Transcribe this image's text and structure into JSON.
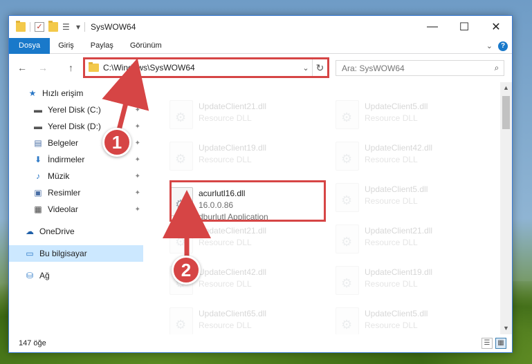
{
  "window": {
    "title": "SysWOW64",
    "controls": {
      "minimize": "—",
      "maximize": "☐",
      "close": "✕"
    }
  },
  "quick_access_toolbar": {
    "dropdown": "▾"
  },
  "ribbon": {
    "tabs": [
      "Dosya",
      "Giriş",
      "Paylaş",
      "Görünüm"
    ],
    "expand": "⌄",
    "help": "?"
  },
  "navigation": {
    "back": "←",
    "forward": "→",
    "up": "↑"
  },
  "address_bar": {
    "path": "C:\\Windows\\SysWOW64",
    "dropdown": "⌄",
    "refresh": "↻"
  },
  "search": {
    "placeholder": "Ara: SysWOW64",
    "icon": "⌕"
  },
  "sidebar": {
    "items": [
      {
        "label": "Hızlı erişim",
        "icon": "star-icon",
        "glyph": "★",
        "color": "#2b78c6",
        "pinned": false
      },
      {
        "label": "Yerel Disk (C:)",
        "icon": "drive-icon",
        "glyph": "▬",
        "color": "#555555",
        "pinned": true
      },
      {
        "label": "Yerel Disk (D:)",
        "icon": "drive-icon",
        "glyph": "▬",
        "color": "#555555",
        "pinned": true
      },
      {
        "label": "Belgeler",
        "icon": "documents-icon",
        "glyph": "▤",
        "color": "#4a6fa5",
        "pinned": true
      },
      {
        "label": "İndirmeler",
        "icon": "download-icon",
        "glyph": "⬇",
        "color": "#2b78c6",
        "pinned": true
      },
      {
        "label": "Müzik",
        "icon": "music-icon",
        "glyph": "♪",
        "color": "#2b78c6",
        "pinned": true
      },
      {
        "label": "Resimler",
        "icon": "pictures-icon",
        "glyph": "▣",
        "color": "#4a6fa5",
        "pinned": true
      },
      {
        "label": "Videolar",
        "icon": "video-icon",
        "glyph": "▦",
        "color": "#444444",
        "pinned": true
      },
      {
        "label": "OneDrive",
        "icon": "cloud-icon",
        "glyph": "☁",
        "color": "#1f5fa8",
        "pinned": false
      },
      {
        "label": "Bu bilgisayar",
        "icon": "computer-icon",
        "glyph": "▭",
        "color": "#2b78c6",
        "pinned": false,
        "selected": true
      },
      {
        "label": "Ağ",
        "icon": "network-icon",
        "glyph": "⛁",
        "color": "#2b78c6",
        "pinned": false
      }
    ],
    "pin_glyph": "✦"
  },
  "files": [
    {
      "name": "UpdateClient21.dll",
      "sub": "Resource DLL",
      "faded": true
    },
    {
      "name": "UpdateClient5.dll",
      "sub": "Resource DLL",
      "faded": true
    },
    {
      "name": "UpdateClient19.dll",
      "sub": "Resource DLL",
      "faded": true
    },
    {
      "name": "UpdateClient42.dll",
      "sub": "Resource DLL",
      "faded": true
    },
    {
      "name": "acurlutl16.dll",
      "sub": "16.0.0.86",
      "sub2": "dburlutl Application",
      "faded": false
    },
    {
      "name": "UpdateClient5.dll",
      "sub": "Resource DLL",
      "faded": true
    },
    {
      "name": "UpdateClient21.dll",
      "sub": "Resource DLL",
      "faded": true
    },
    {
      "name": "UpdateClient21.dll",
      "sub": "Resource DLL",
      "faded": true
    },
    {
      "name": "UpdateClient42.dll",
      "sub": "Resource DLL",
      "faded": true
    },
    {
      "name": "UpdateClient19.dll",
      "sub": "Resource DLL",
      "faded": true
    },
    {
      "name": "UpdateClient65.dll",
      "sub": "Resource DLL",
      "faded": true
    },
    {
      "name": "UpdateClient5.dll",
      "sub": "Resource DLL",
      "faded": true
    }
  ],
  "status": {
    "count": "147 öğe"
  },
  "annotations": {
    "step1": "1",
    "step2": "2",
    "color": "#d64545"
  }
}
